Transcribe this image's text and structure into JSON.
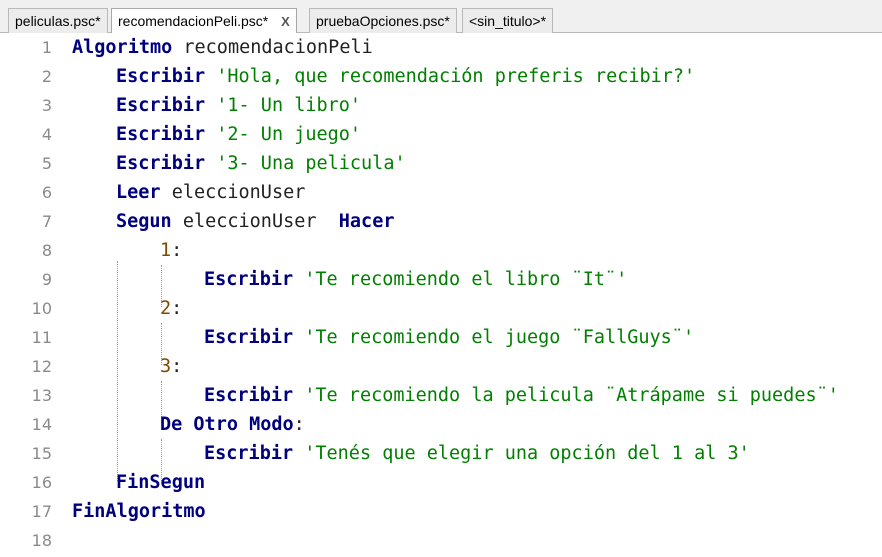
{
  "tabs": [
    {
      "label": "peliculas.psc*",
      "active": false
    },
    {
      "label": "recomendacionPeli.psc*",
      "active": true,
      "close": "X"
    },
    {
      "label": "pruebaOpciones.psc*",
      "active": false
    },
    {
      "label": "<sin_titulo>*",
      "active": false
    }
  ],
  "lines": [
    {
      "n": "1",
      "tokens": [
        {
          "t": "kw",
          "v": "Algoritmo"
        },
        {
          "t": "id",
          "v": " recomendacionPeli"
        }
      ]
    },
    {
      "n": "2",
      "tokens": [
        {
          "t": "kw",
          "v": "Escribir"
        },
        {
          "t": "id",
          "v": " "
        },
        {
          "t": "str",
          "v": "'Hola, que recomendación preferis recibir?'"
        }
      ]
    },
    {
      "n": "3",
      "tokens": [
        {
          "t": "kw",
          "v": "Escribir"
        },
        {
          "t": "id",
          "v": " "
        },
        {
          "t": "str",
          "v": "'1- Un libro'"
        }
      ]
    },
    {
      "n": "4",
      "tokens": [
        {
          "t": "kw",
          "v": "Escribir"
        },
        {
          "t": "id",
          "v": " "
        },
        {
          "t": "str",
          "v": "'2- Un juego'"
        }
      ]
    },
    {
      "n": "5",
      "tokens": [
        {
          "t": "kw",
          "v": "Escribir"
        },
        {
          "t": "id",
          "v": " "
        },
        {
          "t": "str",
          "v": "'3- Una pelicula'"
        }
      ]
    },
    {
      "n": "6",
      "tokens": [
        {
          "t": "kw",
          "v": "Leer"
        },
        {
          "t": "id",
          "v": " eleccionUser"
        }
      ]
    },
    {
      "n": "7",
      "tokens": [
        {
          "t": "kw",
          "v": "Segun"
        },
        {
          "t": "id",
          "v": " eleccionUser  "
        },
        {
          "t": "kw",
          "v": "Hacer"
        }
      ]
    },
    {
      "n": "8",
      "tokens": [
        {
          "t": "num",
          "v": "1"
        },
        {
          "t": "punct",
          "v": ":"
        }
      ]
    },
    {
      "n": "9",
      "tokens": [
        {
          "t": "kw",
          "v": "Escribir"
        },
        {
          "t": "id",
          "v": " "
        },
        {
          "t": "str",
          "v": "'Te recomiendo el libro ¨It¨'"
        }
      ]
    },
    {
      "n": "10",
      "tokens": [
        {
          "t": "num",
          "v": "2"
        },
        {
          "t": "punct",
          "v": ":"
        }
      ]
    },
    {
      "n": "11",
      "tokens": [
        {
          "t": "kw",
          "v": "Escribir"
        },
        {
          "t": "id",
          "v": " "
        },
        {
          "t": "str",
          "v": "'Te recomiendo el juego ¨FallGuys¨'"
        }
      ]
    },
    {
      "n": "12",
      "tokens": [
        {
          "t": "num",
          "v": "3"
        },
        {
          "t": "punct",
          "v": ":"
        }
      ]
    },
    {
      "n": "13",
      "tokens": [
        {
          "t": "kw",
          "v": "Escribir"
        },
        {
          "t": "id",
          "v": " "
        },
        {
          "t": "str",
          "v": "'Te recomiendo la pelicula ¨Atrápame si puedes¨'"
        }
      ]
    },
    {
      "n": "14",
      "tokens": [
        {
          "t": "kw",
          "v": "De Otro Modo"
        },
        {
          "t": "punct",
          "v": ":"
        }
      ]
    },
    {
      "n": "15",
      "tokens": [
        {
          "t": "kw",
          "v": "Escribir"
        },
        {
          "t": "id",
          "v": " "
        },
        {
          "t": "str",
          "v": "'Tenés que elegir una opción del 1 al 3'"
        }
      ]
    },
    {
      "n": "16",
      "tokens": [
        {
          "t": "kw",
          "v": "FinSegun"
        }
      ]
    },
    {
      "n": "17",
      "tokens": [
        {
          "t": "kw",
          "v": "FinAlgoritmo"
        }
      ]
    },
    {
      "n": "18",
      "tokens": []
    }
  ],
  "colors": {
    "keyword": "#00007f",
    "string": "#007f00",
    "number": "#7f4a00",
    "line_number": "#8a8a8a"
  }
}
